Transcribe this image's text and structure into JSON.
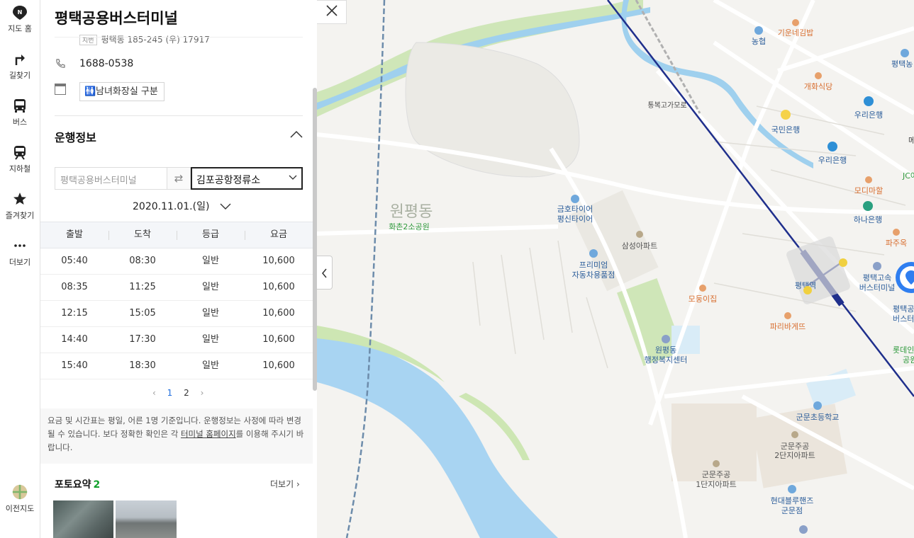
{
  "nav": {
    "items": [
      {
        "label": "지도 홈",
        "icon": "map-home-icon"
      },
      {
        "label": "길찾기",
        "icon": "directions-icon"
      },
      {
        "label": "버스",
        "icon": "bus-icon"
      },
      {
        "label": "지하철",
        "icon": "subway-icon"
      },
      {
        "label": "즐겨찾기",
        "icon": "star-icon"
      },
      {
        "label": "더보기",
        "icon": "more-icon"
      }
    ],
    "legacy_map_label": "이전지도"
  },
  "place": {
    "title": "평택공용버스터미널",
    "address_badge": "지번",
    "address": "평택동 185-245 (우) 17917",
    "phone": "1688-0538",
    "facility": "남녀화장실 구분"
  },
  "schedule": {
    "section_title": "운행정보",
    "from_placeholder": "평택공용버스터미널",
    "to_value": "김포공항정류소",
    "date": "2020.11.01.(일)",
    "headers": [
      "출발",
      "도착",
      "등급",
      "요금"
    ],
    "rows": [
      [
        "05:40",
        "08:30",
        "일반",
        "10,600"
      ],
      [
        "08:35",
        "11:25",
        "일반",
        "10,600"
      ],
      [
        "12:15",
        "15:05",
        "일반",
        "10,600"
      ],
      [
        "14:40",
        "17:30",
        "일반",
        "10,600"
      ],
      [
        "15:40",
        "18:30",
        "일반",
        "10,600"
      ]
    ],
    "pages": [
      "1",
      "2"
    ],
    "current_page": "1",
    "notice_part1": "요금 및 시간표는 평일, 어른 1명 기준입니다. 운행정보는 사정에 따라 변경될 수 있습니다. 보다 정확한 확인은 각 ",
    "notice_link": "터미널 홈페이지",
    "notice_part2": "를 이용해 주시기 바랍니다."
  },
  "photos": {
    "title": "포토요약",
    "count": "2",
    "more": "더보기"
  },
  "map": {
    "area_label": "원평동",
    "labels": {
      "kinone": "기운네김밥",
      "nonghyup": "농협",
      "gaewon": "개화식당",
      "tongbok": "통복고가모로",
      "woori1": "우리은행",
      "kookmin": "국민은행",
      "woori2": "우리은행",
      "jc": "JC어린",
      "modi": "모디마할",
      "hana": "하나은행",
      "pajuk": "파주옥",
      "park": "화촌2소공원",
      "kumho": "금호타이어\n평신타이어",
      "samsung": "삼성아파트",
      "premium": "프리미엄\n자동차용품점",
      "pyeongtaek_stn": "평택역",
      "express": "평택고속\n버스터미널",
      "modung": "모둥이집",
      "paris": "파리바게뜨",
      "wonpyeong_office": "원평동\n행정복지센터",
      "gunmun_school": "군문초등학교",
      "gunmun2": "군문주공\n2단지아파트",
      "gunmun1": "군문주공\n1단지아파트",
      "hyundai": "현대블루핸즈\n군문점",
      "lotte": "롯데인\n공원",
      "pyeongtaek_right": "평택공\n버스터",
      "me": "메",
      "pyeongtaek_top": "평택농"
    }
  }
}
